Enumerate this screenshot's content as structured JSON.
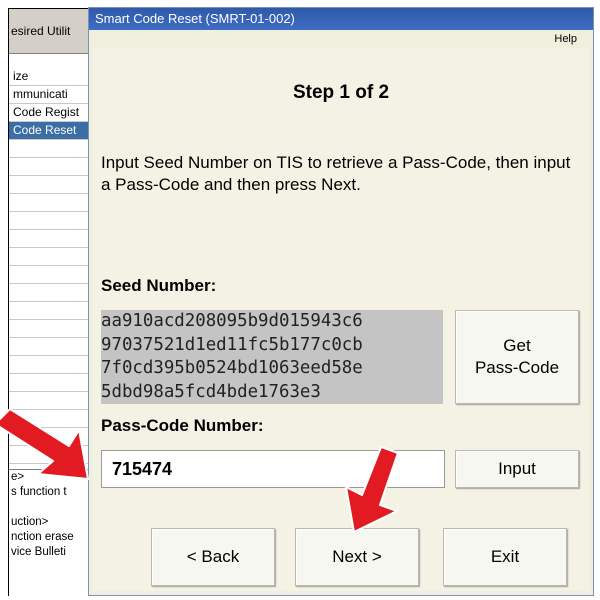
{
  "background_window": {
    "title": "esired Utilit",
    "menu_items": [
      "ize",
      "mmunicati",
      "Code Regist",
      "Code Reset"
    ],
    "selected_index": 3,
    "notes": [
      "e>",
      "s function t",
      "",
      "uction>",
      "nction erase",
      "vice Bulleti"
    ]
  },
  "dialog": {
    "title": "Smart Code Reset (SMRT-01-002)",
    "menu_help": "Help",
    "step_title": "Step 1 of 2",
    "instructions": "Input Seed Number on TIS to retrieve a Pass-Code, then input a Pass-Code and then press Next.",
    "seed_label": "Seed Number:",
    "seed_lines": [
      "aa910acd208095b9d015943c6",
      "97037521d1ed11fc5b177c0cb",
      "7f0cd395b0524bd1063eed58e",
      "5dbd98a5fcd4bde1763e3"
    ],
    "get_code_button": {
      "line1": "Get",
      "line2": "Pass-Code"
    },
    "passcode_label": "Pass-Code Number:",
    "passcode_value": "715474",
    "input_button": "Input",
    "back_button": "< Back",
    "next_button": "Next >",
    "exit_button": "Exit"
  },
  "annotations": {
    "arrow_color": "#e21b23",
    "arrows": [
      "arrow-to-passcode-field",
      "arrow-to-next-button"
    ]
  }
}
